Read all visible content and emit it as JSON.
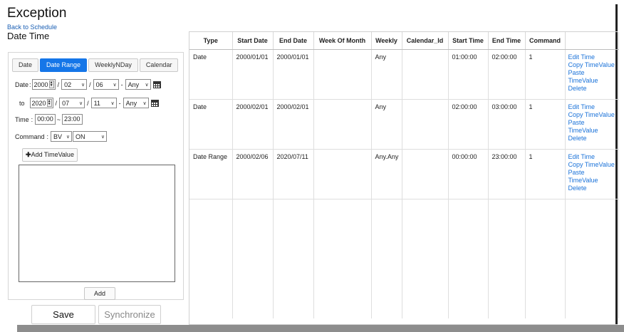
{
  "page": {
    "title": "Exception",
    "back_link": "Back to Schedule",
    "section_title": "Date Time"
  },
  "tabs": [
    {
      "label": "Date",
      "active": false
    },
    {
      "label": "Date Range",
      "active": true
    },
    {
      "label": "WeeklyNDay",
      "active": false
    },
    {
      "label": "Calendar",
      "active": false
    }
  ],
  "form": {
    "date_from": {
      "label": "Date",
      "year": "2000",
      "month": "02",
      "day": "06",
      "weekday": "Any"
    },
    "date_to": {
      "label": "to",
      "year": "2020",
      "month": "07",
      "day": "11",
      "weekday": "Any"
    },
    "separators": {
      "slash": "/",
      "dash": "-",
      "tilde": "~",
      "colon": ":"
    },
    "time": {
      "label": "Time",
      "start": "00:00",
      "end": "23:00"
    },
    "command": {
      "label": "Command",
      "object": "BV",
      "value": "ON"
    },
    "add_time_value_label": "Add TimeValue",
    "add_label": "Add"
  },
  "footer": {
    "save_label": "Save",
    "synchronize_label": "Synchronize"
  },
  "table": {
    "columns": [
      "Type",
      "Start Date",
      "End Date",
      "Week Of Month",
      "Weekly",
      "Calendar_Id",
      "Start Time",
      "End Time",
      "Command",
      ""
    ],
    "actions": [
      "Edit Time",
      "Copy TimeValue",
      "Paste TimeValue",
      "Delete"
    ],
    "rows": [
      {
        "type": "Date",
        "start_date": "2000/01/01",
        "end_date": "2000/01/01",
        "week_of_month": "",
        "weekly": "Any",
        "calendar_id": "",
        "start_time": "01:00:00",
        "end_time": "02:00:00",
        "command": "1"
      },
      {
        "type": "Date",
        "start_date": "2000/02/01",
        "end_date": "2000/02/01",
        "week_of_month": "",
        "weekly": "Any",
        "calendar_id": "",
        "start_time": "02:00:00",
        "end_time": "03:00:00",
        "command": "1"
      },
      {
        "type": "Date Range",
        "start_date": "2000/02/06",
        "end_date": "2020/07/11",
        "week_of_month": "",
        "weekly": "Any.Any",
        "calendar_id": "",
        "start_time": "00:00:00",
        "end_time": "23:00:00",
        "command": "1"
      }
    ]
  },
  "colors": {
    "accent": "#1576e8",
    "link": "#1a72d9"
  }
}
